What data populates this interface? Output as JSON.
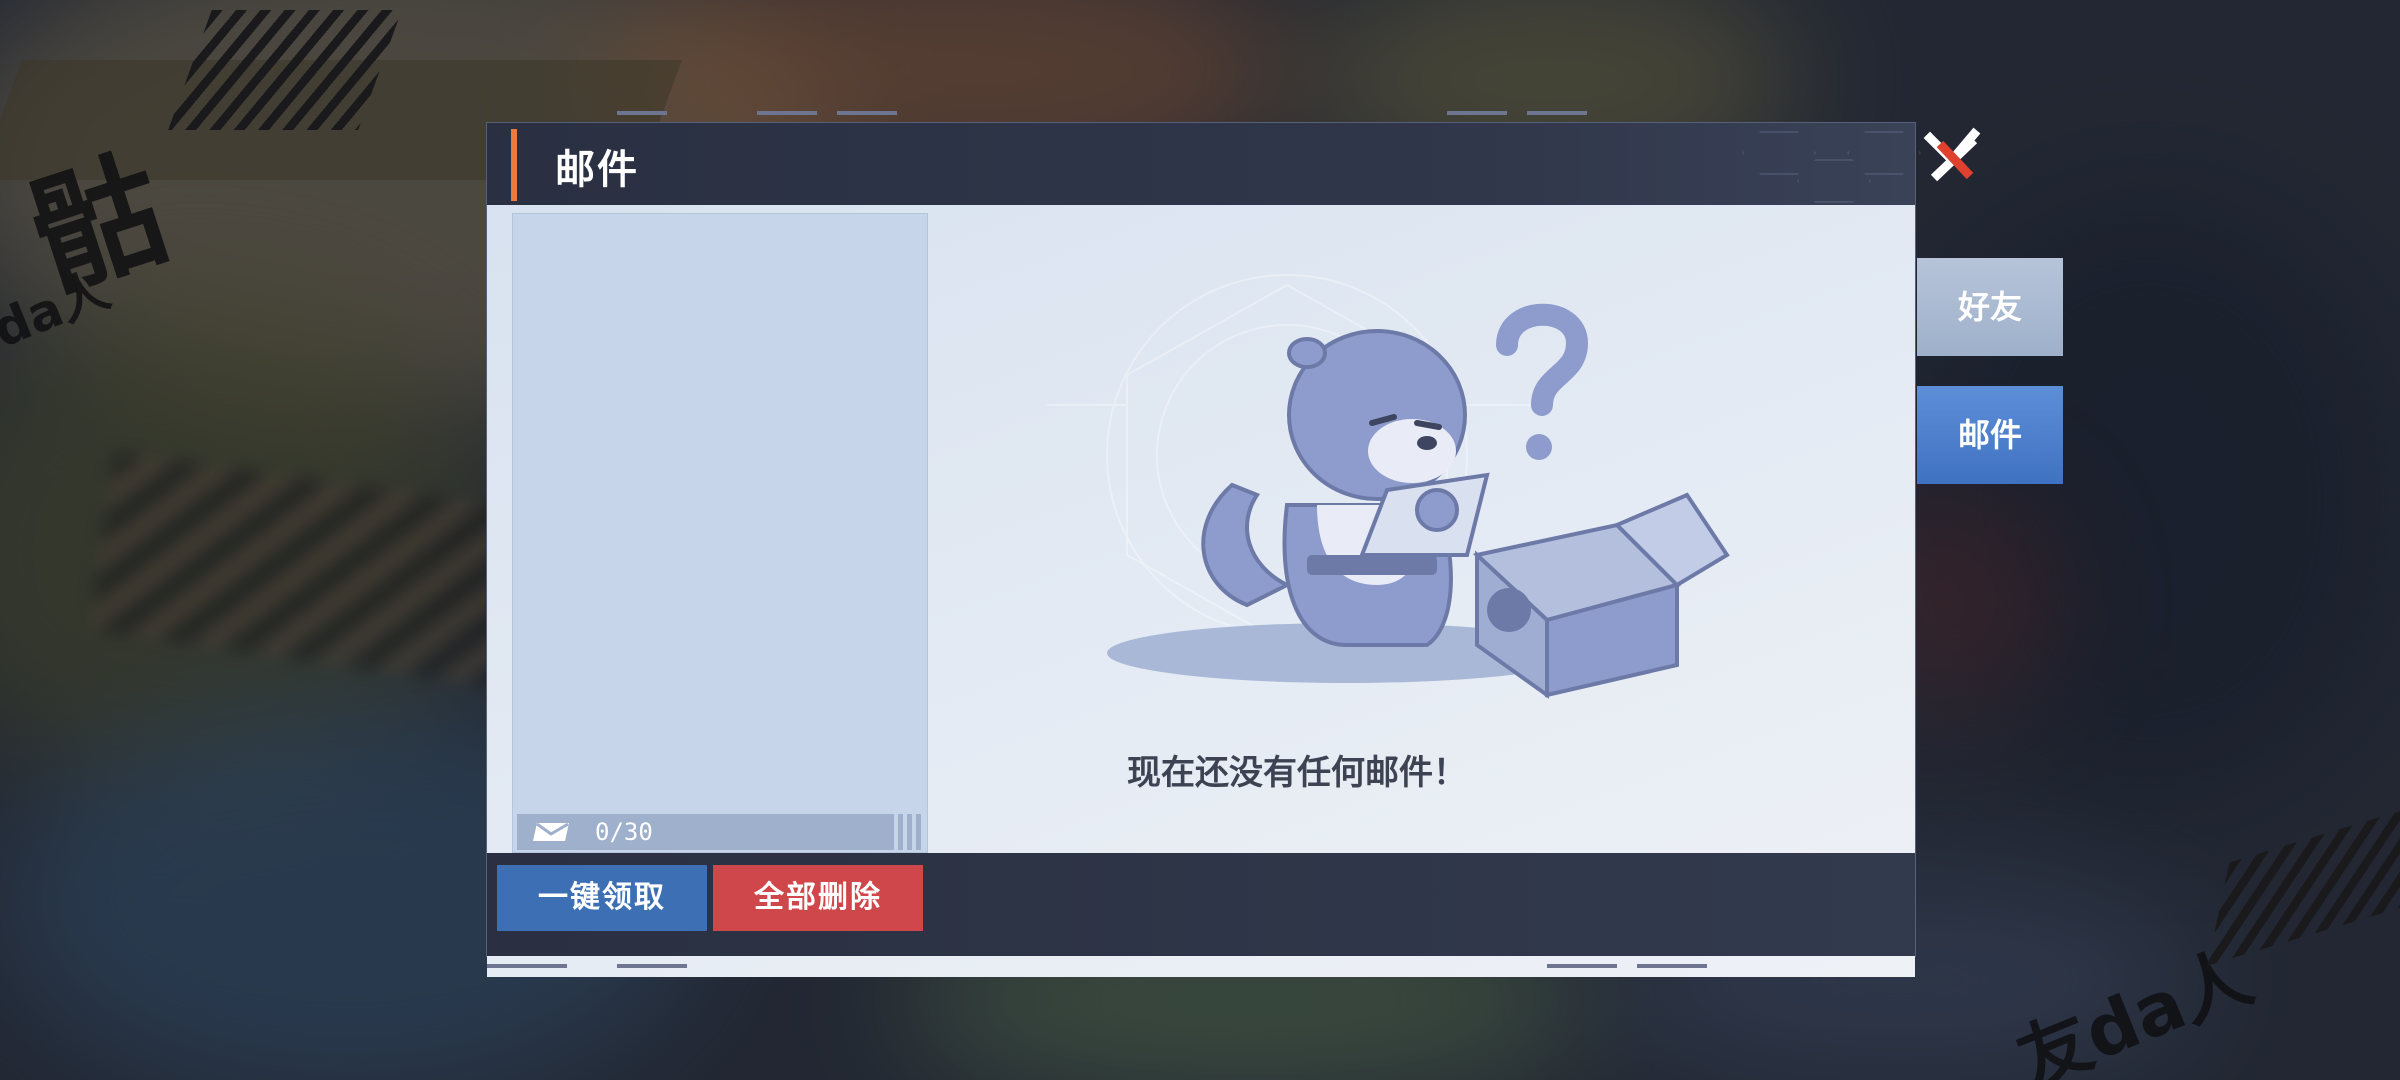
{
  "dialog": {
    "title": "邮件",
    "empty_message": "现在还没有任何邮件！",
    "mail_count": "0/30"
  },
  "buttons": {
    "claim_all": "一键领取",
    "delete_all": "全部删除"
  },
  "side_tabs": [
    {
      "label": "好友",
      "active": false
    },
    {
      "label": "邮件",
      "active": true
    }
  ],
  "decor": {
    "corner_text_top": "骷",
    "corner_text_top_small": "da人",
    "corner_text_bottom": "友da人"
  },
  "colors": {
    "accent_orange": "#f07a3a",
    "claim_blue": "#3d6fb5",
    "delete_red": "#d0474b",
    "active_tab": "#4a7dcc"
  },
  "icons": [
    "close-icon",
    "mail-icon",
    "otter-mascot",
    "question-mark-icon",
    "open-box-icon"
  ]
}
